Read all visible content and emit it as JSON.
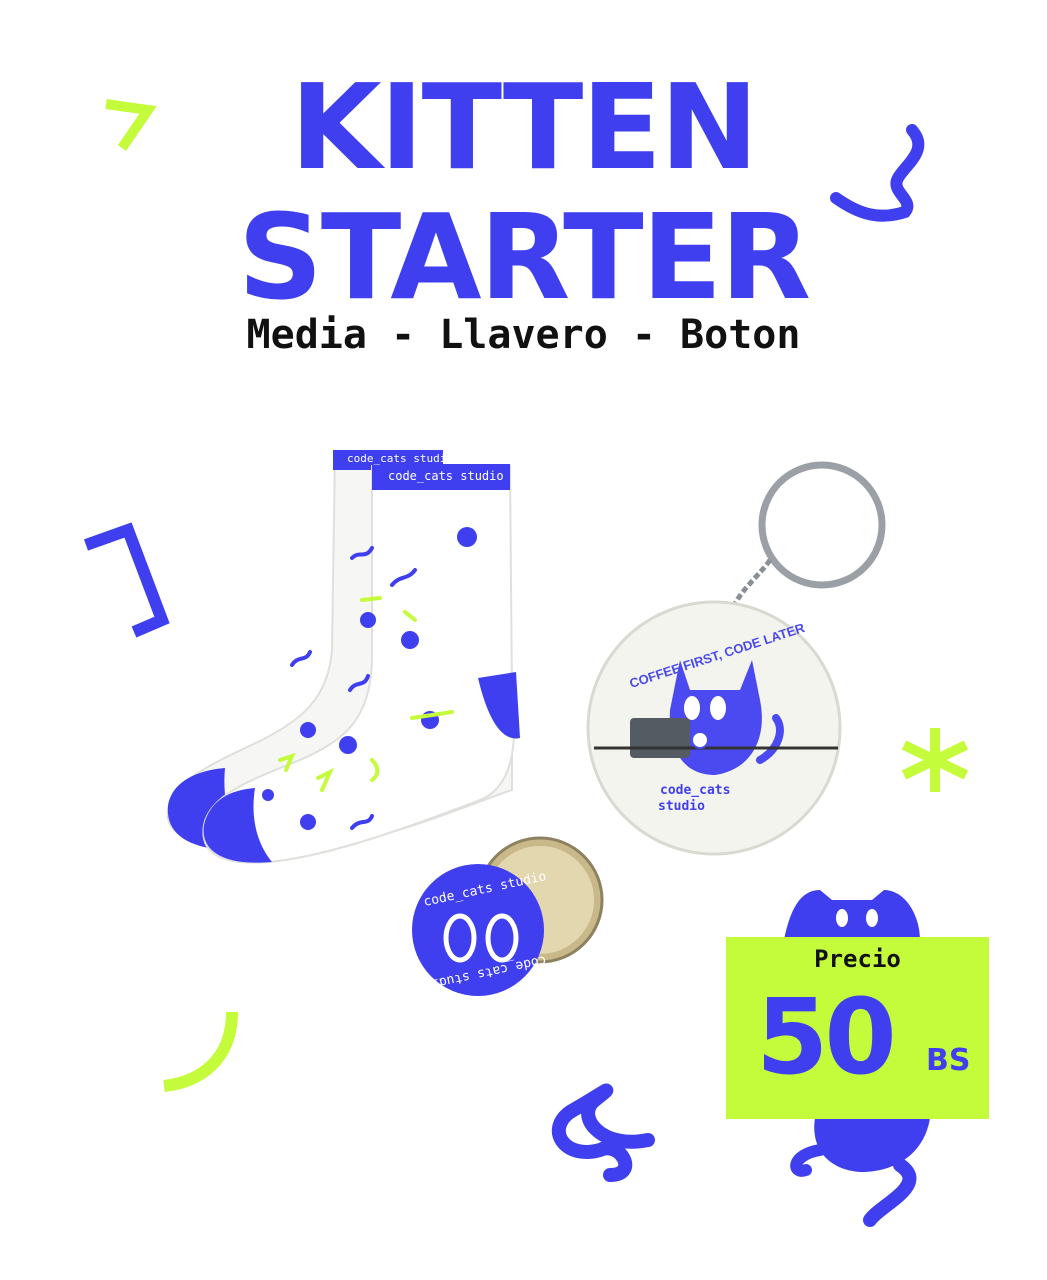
{
  "header": {
    "title_line_1": "KITTEN",
    "title_line_2": "STARTER",
    "subtitle": "Media - Llavero - Boton"
  },
  "products": {
    "sock_brand": "code_cats studio",
    "keychain_slogan": "COFFEE FIRST, CODE LATER",
    "keychain_brand_line_1": "code_cats",
    "keychain_brand_line_2": "studio",
    "button_text_top": "code_cats studio",
    "button_text_bottom": "code_cats studio",
    "button_face": "O O"
  },
  "price": {
    "label": "Precio",
    "amount": "50",
    "currency": "BS"
  },
  "colors": {
    "brand_blue": "#3f3ff0",
    "lime": "#c4fb3b",
    "text_dark": "#111111"
  }
}
